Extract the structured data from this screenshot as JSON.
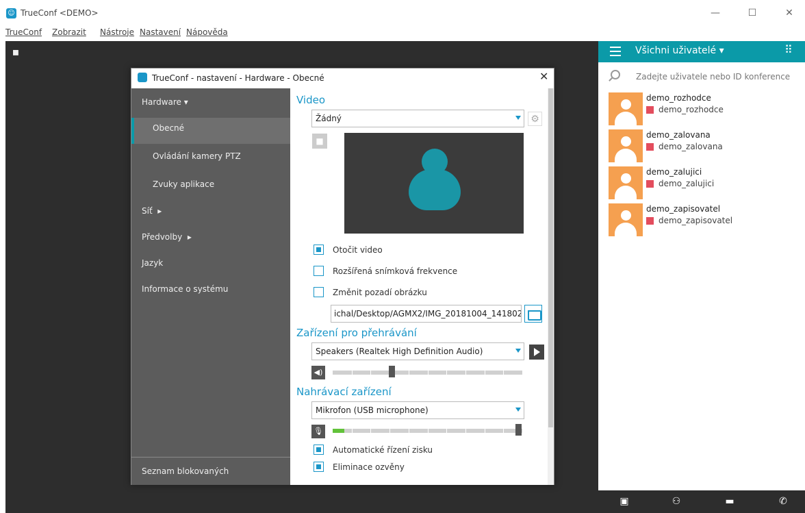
{
  "app": {
    "title": "TrueConf <DEMO>",
    "window_controls": [
      "—",
      "☐",
      "✕"
    ]
  },
  "menubar": [
    "TrueConf",
    "Zobrazit",
    "Nástroje",
    "Nastavení",
    "Nápověda"
  ],
  "right_panel": {
    "header_title": "Všichni uživatelé ▾",
    "search_placeholder": "Zadejte uživatele nebo ID konference",
    "contacts": [
      {
        "name": "demo_rozhodce",
        "id": "demo_rozhodce"
      },
      {
        "name": "demo_zalovana",
        "id": "demo_zalovana"
      },
      {
        "name": "demo_zalujici",
        "id": "demo_zalujici"
      },
      {
        "name": "demo_zapisovatel",
        "id": "demo_zapisovatel"
      }
    ],
    "footer_icons": [
      "contacts-icon",
      "group-icon",
      "chat-icon",
      "call-icon"
    ],
    "status_color": "#e34d5d",
    "accent_color": "#0b9aa8"
  },
  "dialog": {
    "title": "TrueConf - nastavení - Hardware - Obecné",
    "nav": {
      "hardware": "Hardware",
      "obecne": "Obecné",
      "ptz": "Ovládání kamery PTZ",
      "zvuky": "Zvuky aplikace",
      "sit": "Síť",
      "predvolby": "Předvolby",
      "jazyk": "Jazyk",
      "info": "Informace o systému",
      "blocked": "Seznam blokovaných"
    },
    "video": {
      "heading": "Video",
      "device": "Žádný",
      "rotate_label": "Otočit video",
      "rotate_checked": true,
      "framerate_label": "Rozšířená snímková frekvence",
      "framerate_checked": false,
      "bg_label": "Změnit pozadí obrázku",
      "bg_checked": false,
      "bg_path": "ichal/Desktop/AGMX2/IMG_20181004_141802.jpg"
    },
    "playback": {
      "heading": "Zařízení pro přehrávání",
      "device": "Speakers (Realtek High Definition Audio)",
      "volume_fraction": 0.31
    },
    "recording": {
      "heading": "Nahrávací zařízení",
      "device": "Mikrofon (USB microphone)",
      "level_fraction": 0.06,
      "gain_fraction": 0.98,
      "agc_label": "Automatické řízení zisku",
      "agc_checked": true,
      "echo_label": "Eliminace ozvěny",
      "echo_checked": true
    }
  }
}
